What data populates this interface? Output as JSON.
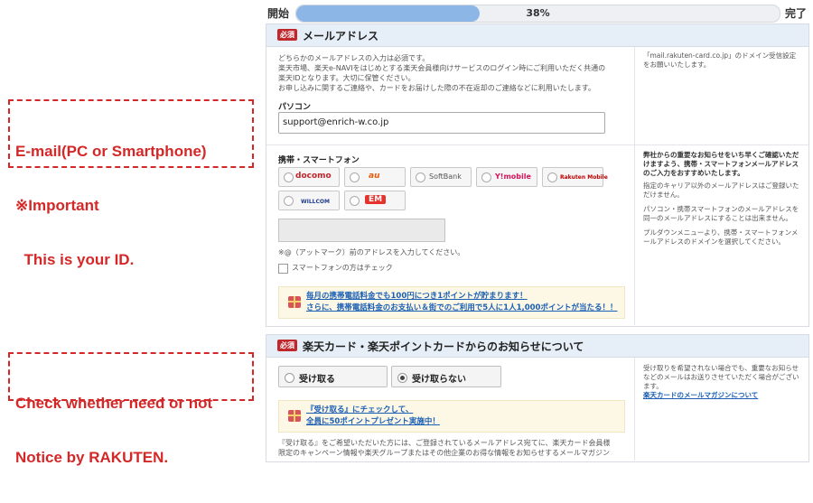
{
  "progress": {
    "start_label": "開始",
    "end_label": "完了",
    "percent_text": "38%",
    "percent": 38
  },
  "email_section": {
    "required_badge": "必須",
    "title": "メールアドレス",
    "desc_lines": [
      "どちらかのメールアドレスの入力は必須です。",
      "楽天市場、楽天e-NAVIをはじめとする楽天会員様向けサービスのログイン時にご利用いただく共通の",
      "楽天IDとなります。大切に保管ください。",
      "お申し込みに関するご連絡や、カードをお届けした際の不在返却のご連絡などに利用いたします。"
    ],
    "pc_label": "パソコン",
    "pc_value": "support@enrich-w.co.jp",
    "pc_side_note_lines": [
      "「mail.rakuten-card.co.jp」のドメイン受信設定",
      "をお願いいたします。"
    ],
    "mobile_label": "携帯・スマートフォン",
    "carriers": [
      "docomo",
      "au",
      "SoftBank",
      "Y!mobile",
      "Rakuten Mobile",
      "WILLCOM",
      "EM"
    ],
    "mobile_hint": "※@（アットマーク）前のアドレスを入力してください。",
    "smartphone_check_label": "スマートフォンの方はチェック",
    "promo_lines": [
      "毎月の携帯電話料金でも100円につき1ポイントが貯まります！",
      "さらに、携帯電話料金のお支払い＆街でのご利用で5人に1人1,000ポイントが当たる！！"
    ],
    "mobile_side_note_lines_bold": [
      "弊社からの重要なお知らせをいち早くご確認いただ",
      "けますよう、携帯・スマートフォンメールアドレス",
      "のご入力をおすすめいたします。"
    ],
    "mobile_side_note_lines": [
      "指定のキャリア以外のメールアドレスはご登録いた",
      "だけません。",
      "",
      "パソコン・携帯スマートフォンのメールアドレスを",
      "同一のメールアドレスにすることは出来ません。",
      "",
      "プルダウンメニューより、携帯・スマートフォンメ",
      "ールアドレスのドメインを選択してください。"
    ]
  },
  "notice_section": {
    "required_badge": "必須",
    "title": "楽天カード・楽天ポイントカードからのお知らせについて",
    "option_receive": "受け取る",
    "option_not_receive": "受け取らない",
    "promo_lines": [
      "『受け取る』にチェックして、",
      "全員に50ポイントプレゼント実施中！"
    ],
    "body_lines": [
      "『受け取る』をご希望いただいた方には、ご登録されているメールアドレス宛てに、楽天カード会員様",
      "限定のキャンペーン情報や楽天グループまたはその他企業のお得な情報をお知らせするメールマガジン"
    ],
    "side_note_lines": [
      "受け取りを希望されない場合でも、重要なお知らせ",
      "などのメールはお送りさせていただく場合がござい",
      "ます。"
    ],
    "side_link": "楽天カードのメールマガジンについて"
  },
  "callouts": {
    "email_lines": [
      "E-mail(PC or Smartphone)",
      "※Important",
      "  This is your ID."
    ],
    "notice_lines": [
      "Check whether need or not",
      "Notice by RAKUTEN."
    ]
  },
  "colors": {
    "callout": "#d42828",
    "progress_fill": "#8cb6e6",
    "required": "#c0272d",
    "link": "#1a5fb4"
  }
}
